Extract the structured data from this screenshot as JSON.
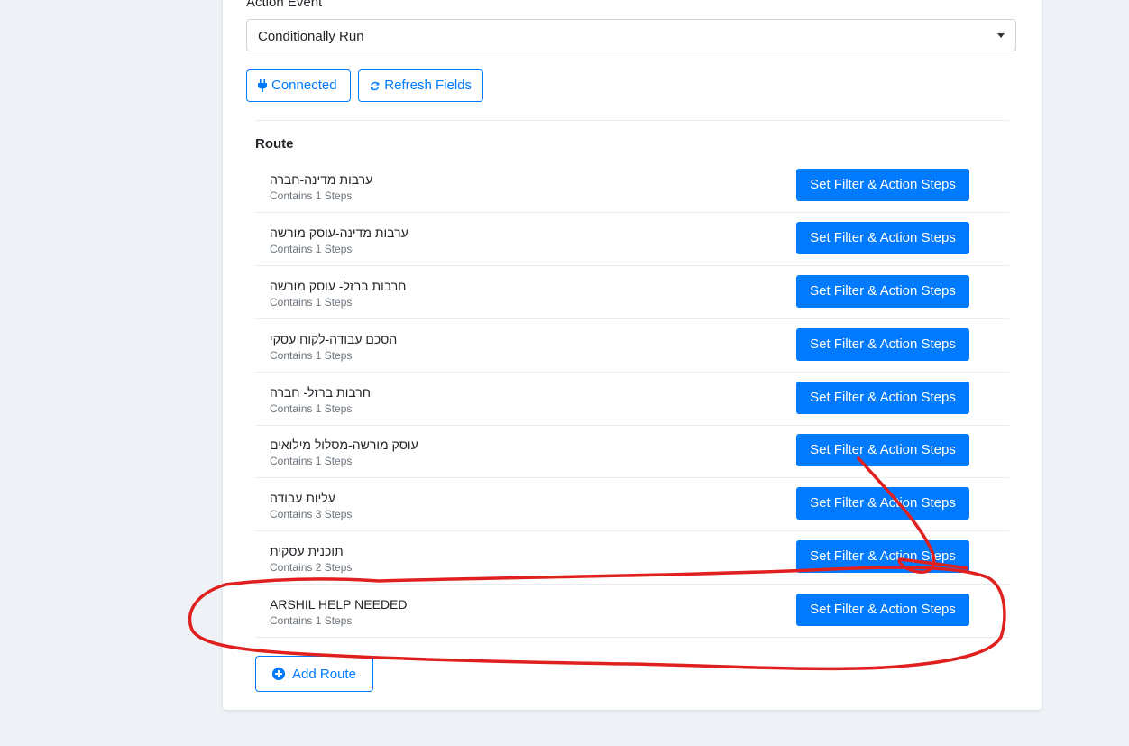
{
  "form": {
    "action_event_label": "Action Event",
    "action_event_value": "Conditionally Run",
    "connected_label": "Connected",
    "refresh_label": "Refresh Fields"
  },
  "route": {
    "title": "Route",
    "button_label": "Set Filter & Action Steps",
    "items": [
      {
        "name": "ערבות מדינה-חברה",
        "steps": "Contains 1 Steps"
      },
      {
        "name": "ערבות מדינה-עוסק מורשה",
        "steps": "Contains 1 Steps"
      },
      {
        "name": "חרבות ברזל- עוסק מורשה",
        "steps": "Contains 1 Steps"
      },
      {
        "name": "הסכם עבודה-לקוח עסקי",
        "steps": "Contains 1 Steps"
      },
      {
        "name": "חרבות ברזל- חברה",
        "steps": "Contains 1 Steps"
      },
      {
        "name": "עוסק מורשה-מסלול מילואים",
        "steps": "Contains 1 Steps"
      },
      {
        "name": "עליות עבודה",
        "steps": "Contains 3 Steps"
      },
      {
        "name": "תוכנית עסקית",
        "steps": "Contains 2 Steps"
      },
      {
        "name": "ARSHIL HELP NEEDED",
        "steps": "Contains 1 Steps"
      }
    ],
    "add_label": "Add Route"
  },
  "colors": {
    "primary": "#007bff",
    "annotation": "#e0201f",
    "background": "#eef2f7"
  }
}
